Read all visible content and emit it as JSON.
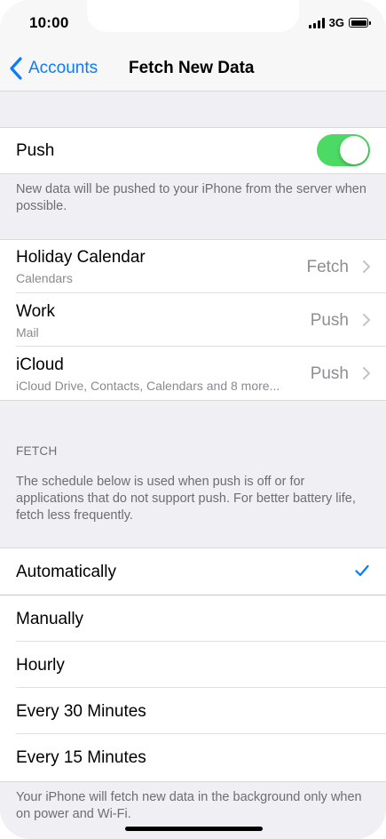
{
  "status_bar": {
    "time": "10:00",
    "network": "3G"
  },
  "nav": {
    "back_label": "Accounts",
    "title": "Fetch New Data"
  },
  "push": {
    "label": "Push",
    "enabled": true,
    "description": "New data will be pushed to your iPhone from the server when possible."
  },
  "accounts": [
    {
      "title": "Holiday Calendar",
      "subtitle": "Calendars",
      "value": "Fetch"
    },
    {
      "title": "Work",
      "subtitle": "Mail",
      "value": "Push"
    },
    {
      "title": "iCloud",
      "subtitle": "iCloud Drive, Contacts, Calendars and 8 more...",
      "value": "Push"
    }
  ],
  "fetch": {
    "header": "FETCH",
    "description": "The schedule below is used when push is off or for applications that do not support push. For better battery life, fetch less frequently.",
    "selected": "Automatically",
    "options": [
      {
        "label": "Automatically"
      },
      {
        "label": "Manually"
      },
      {
        "label": "Hourly"
      },
      {
        "label": "Every 30 Minutes"
      },
      {
        "label": "Every 15 Minutes"
      }
    ],
    "footer": "Your iPhone will fetch new data in the background only when on power and Wi-Fi."
  },
  "colors": {
    "accent": "#0a7aff",
    "toggle_on": "#4cd964",
    "background": "#efeff4"
  },
  "icons": {
    "back": "chevron-left-icon",
    "disclosure": "chevron-right-icon",
    "selected": "checkmark-icon"
  }
}
